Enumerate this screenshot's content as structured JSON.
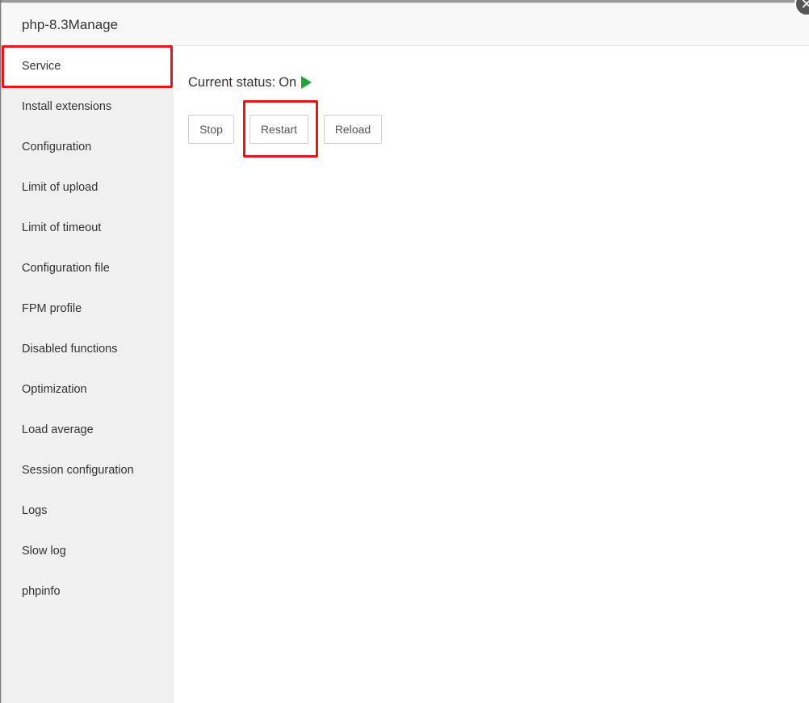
{
  "dialog": {
    "title": "php-8.3Manage",
    "close_symbol": "✕"
  },
  "sidebar": {
    "items": [
      {
        "label": "Service",
        "active": true
      },
      {
        "label": "Install extensions"
      },
      {
        "label": "Configuration"
      },
      {
        "label": "Limit of upload"
      },
      {
        "label": "Limit of timeout"
      },
      {
        "label": "Configuration file"
      },
      {
        "label": "FPM profile"
      },
      {
        "label": "Disabled functions"
      },
      {
        "label": "Optimization"
      },
      {
        "label": "Load average"
      },
      {
        "label": "Session configuration"
      },
      {
        "label": "Logs"
      },
      {
        "label": "Slow log"
      },
      {
        "label": "phpinfo"
      }
    ]
  },
  "service": {
    "status_label": "Current status:",
    "status_value": "On",
    "status_icon": "play-icon",
    "status_color": "#20a53a",
    "buttons": {
      "stop": "Stop",
      "restart": "Restart",
      "reload": "Reload"
    }
  },
  "annotations": {
    "highlight_color": "#e8141c"
  }
}
